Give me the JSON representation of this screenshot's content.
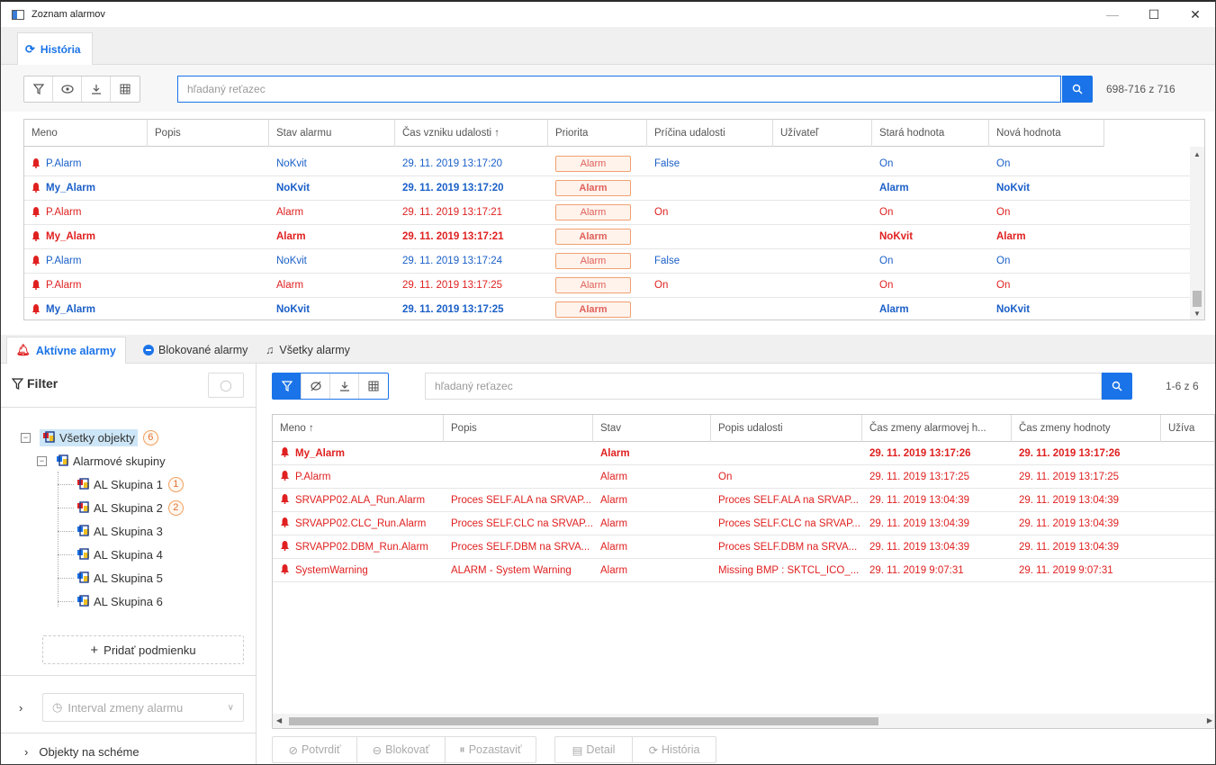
{
  "window": {
    "title": "Zoznam alarmov",
    "minimize": "—",
    "maximize": "☐",
    "close": "✕"
  },
  "history_tab": {
    "label": "História"
  },
  "top_toolbar": {
    "search_placeholder": "hľadaný reťazec",
    "count": "698-716 z 716"
  },
  "top_grid": {
    "columns": [
      "Meno",
      "Popis",
      "Stav alarmu",
      "Čas vzniku udalosti ↑",
      "Priorita",
      "Príčina udalosti",
      "Užívateľ",
      "Stará hodnota",
      "Nová hodnota"
    ],
    "rows": [
      {
        "name": "P.Alarm",
        "status": "NoKvit",
        "time": "29. 11. 2019 13:17:20",
        "priority": "Alarm",
        "cause": "False",
        "old": "On",
        "new": "On",
        "color": "blue",
        "bold": false
      },
      {
        "name": "My_Alarm",
        "status": "NoKvit",
        "time": "29. 11. 2019 13:17:20",
        "priority": "Alarm",
        "cause": "",
        "old": "Alarm",
        "new": "NoKvit",
        "color": "blue",
        "bold": true
      },
      {
        "name": "P.Alarm",
        "status": "Alarm",
        "time": "29. 11. 2019 13:17:21",
        "priority": "Alarm",
        "cause": "On",
        "old": "On",
        "new": "On",
        "color": "red",
        "bold": false
      },
      {
        "name": "My_Alarm",
        "status": "Alarm",
        "time": "29. 11. 2019 13:17:21",
        "priority": "Alarm",
        "cause": "",
        "old": "NoKvit",
        "new": "Alarm",
        "color": "red",
        "bold": true
      },
      {
        "name": "P.Alarm",
        "status": "NoKvit",
        "time": "29. 11. 2019 13:17:24",
        "priority": "Alarm",
        "cause": "False",
        "old": "On",
        "new": "On",
        "color": "blue",
        "bold": false
      },
      {
        "name": "P.Alarm",
        "status": "Alarm",
        "time": "29. 11. 2019 13:17:25",
        "priority": "Alarm",
        "cause": "On",
        "old": "On",
        "new": "On",
        "color": "red",
        "bold": false
      },
      {
        "name": "My_Alarm",
        "status": "NoKvit",
        "time": "29. 11. 2019 13:17:25",
        "priority": "Alarm",
        "cause": "",
        "old": "Alarm",
        "new": "NoKvit",
        "color": "blue",
        "bold": true
      }
    ]
  },
  "bottom_tabs": [
    {
      "label": "Aktívne alarmy"
    },
    {
      "label": "Blokované alarmy"
    },
    {
      "label": "Všetky alarmy"
    }
  ],
  "filter": {
    "title": "Filter",
    "tree": {
      "root": {
        "label": "Všetky objekty",
        "count": "6"
      },
      "group": {
        "label": "Alarmové skupiny"
      },
      "items": [
        {
          "label": "AL Skupina 1",
          "count": "1"
        },
        {
          "label": "AL Skupina 2",
          "count": "2"
        },
        {
          "label": "AL Skupina 3",
          "count": ""
        },
        {
          "label": "AL Skupina 4",
          "count": ""
        },
        {
          "label": "AL Skupina 5",
          "count": ""
        },
        {
          "label": "AL Skupina 6",
          "count": ""
        }
      ]
    },
    "add_condition": "Pridať podmienku",
    "interval": "Interval zmeny alarmu",
    "objects_on_scheme": "Objekty na schéme"
  },
  "bottom_toolbar": {
    "search_placeholder": "hľadaný reťazec",
    "count": "1-6 z 6"
  },
  "bottom_grid": {
    "columns": [
      "Meno ↑",
      "Popis",
      "Stav",
      "Popis udalosti",
      "Čas zmeny alarmovej h...",
      "Čas zmeny hodnoty",
      "Užíva"
    ],
    "rows": [
      {
        "name": "My_Alarm",
        "desc": "",
        "status": "Alarm",
        "event": "",
        "alarm_time": "29. 11. 2019 13:17:26",
        "value_time": "29. 11. 2019 13:17:26",
        "bold": true
      },
      {
        "name": "P.Alarm",
        "desc": "",
        "status": "Alarm",
        "event": "On",
        "alarm_time": "29. 11. 2019 13:17:25",
        "value_time": "29. 11. 2019 13:17:25",
        "bold": false
      },
      {
        "name": "SRVAPP02.ALA_Run.Alarm",
        "desc": "Proces SELF.ALA na SRVAP...",
        "status": "Alarm",
        "event": "Proces SELF.ALA na SRVAP...",
        "alarm_time": "29. 11. 2019 13:04:39",
        "value_time": "29. 11. 2019 13:04:39",
        "bold": false
      },
      {
        "name": "SRVAPP02.CLC_Run.Alarm",
        "desc": "Proces SELF.CLC na SRVAP...",
        "status": "Alarm",
        "event": "Proces SELF.CLC na SRVAP...",
        "alarm_time": "29. 11. 2019 13:04:39",
        "value_time": "29. 11. 2019 13:04:39",
        "bold": false
      },
      {
        "name": "SRVAPP02.DBM_Run.Alarm",
        "desc": "Proces SELF.DBM na SRVA...",
        "status": "Alarm",
        "event": "Proces SELF.DBM na SRVA...",
        "alarm_time": "29. 11. 2019 13:04:39",
        "value_time": "29. 11. 2019 13:04:39",
        "bold": false
      },
      {
        "name": "SystemWarning",
        "desc": "ALARM - System Warning",
        "status": "Alarm",
        "event": "Missing BMP : SKTCL_ICO_...",
        "alarm_time": "29. 11. 2019 9:07:31",
        "value_time": "29. 11. 2019 9:07:31",
        "bold": false
      }
    ]
  },
  "actions": {
    "confirm": "Potvrdiť",
    "block": "Blokovať",
    "pause": "Pozastaviť",
    "detail": "Detail",
    "history": "História"
  },
  "colors": {
    "accent": "#1a73e8",
    "alarm_red": "#e02020",
    "nokvit_blue": "#1a5fc8",
    "priority_border": "#f0a070"
  }
}
